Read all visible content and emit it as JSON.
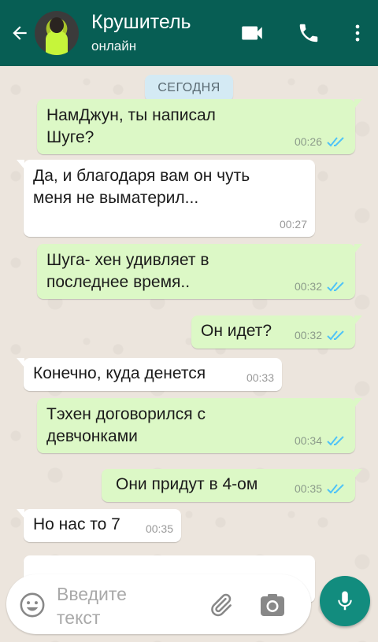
{
  "header": {
    "contact_name": "Крушитель",
    "status": "онлайн",
    "back_icon": "arrow-back-icon",
    "video_icon": "videocam-icon",
    "call_icon": "phone-icon",
    "menu_icon": "more-vert-icon"
  },
  "chat": {
    "date_chip": "СЕГОДНЯ",
    "messages": [
      {
        "direction": "out",
        "text": "НамДжун, ты написал Шуге?",
        "time": "00:26",
        "read": true
      },
      {
        "direction": "in",
        "text": "Да, и благодаря вам он чуть меня не выматерил...",
        "time": "00:27"
      },
      {
        "direction": "out",
        "text": "Шуга- хен удивляет в последнее время..",
        "time": "00:32",
        "read": true
      },
      {
        "direction": "out",
        "text": "Он идет?",
        "time": "00:32",
        "read": true
      },
      {
        "direction": "in",
        "text": "Конечно, куда денется",
        "time": "00:33"
      },
      {
        "direction": "out",
        "text": "Тэхен договорился с девчонками",
        "time": "00:34",
        "read": true
      },
      {
        "direction": "out",
        "text": "Они придут в 4-ом",
        "time": "00:35",
        "read": true
      },
      {
        "direction": "in",
        "text": "Но нас то 7",
        "time": "00:35"
      }
    ]
  },
  "input": {
    "placeholder": "Введите текст",
    "emoji_icon": "emoji-icon",
    "attach_icon": "paperclip-icon",
    "camera_icon": "camera-icon",
    "mic_icon": "mic-icon"
  },
  "colors": {
    "header": "#075E54",
    "outgoing_bubble": "#DCF8C6",
    "incoming_bubble": "#FFFFFF",
    "read_ticks": "#4FC3F7",
    "mic_button": "#128C7E",
    "wallpaper": "#ECE5DD"
  }
}
